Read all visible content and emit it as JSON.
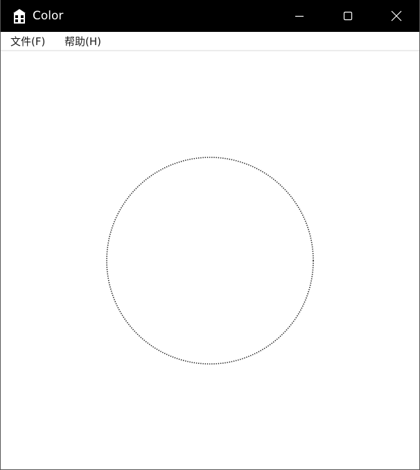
{
  "window": {
    "title": "Color",
    "icon": "app-building-icon"
  },
  "title_bar_buttons": {
    "minimize_icon": "minimize-icon",
    "maximize_icon": "maximize-icon",
    "close_icon": "close-icon"
  },
  "menu": {
    "items": [
      {
        "label": "文件(F)"
      },
      {
        "label": "帮助(H)"
      }
    ]
  },
  "canvas": {
    "shape": "circle",
    "line_style": "dotted",
    "line_color": "#222222",
    "background": "#ffffff"
  }
}
